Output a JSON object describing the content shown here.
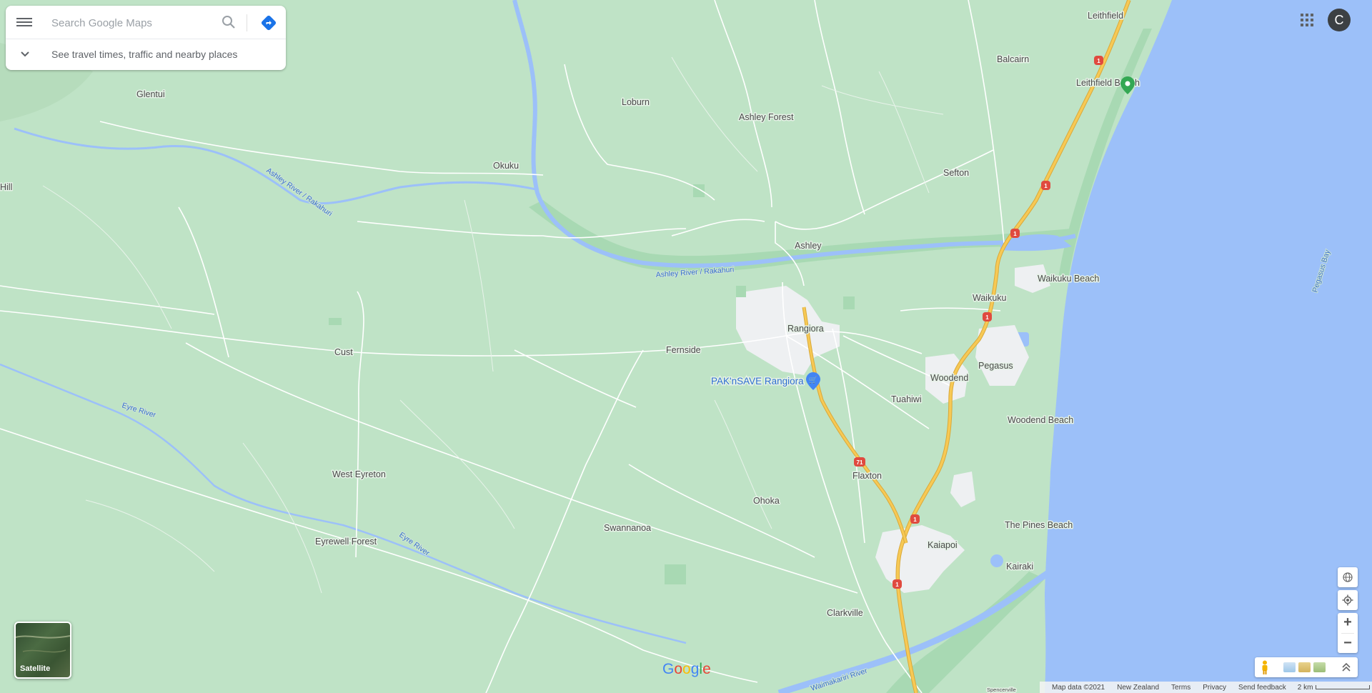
{
  "search": {
    "placeholder": "Search Google Maps",
    "travel_hint": "See travel times, traffic and nearby places"
  },
  "account": {
    "avatar_letter": "C"
  },
  "map_labels": {
    "places": [
      "Leithfield",
      "Balcairn",
      "Leithfield Beach",
      "Loburn",
      "Ashley Forest",
      "Glentui",
      "Okuku",
      "Sefton",
      "Hill",
      "Ashley",
      "Waikuku Beach",
      "Waikuku",
      "Rangiora",
      "Cust",
      "Fernside",
      "Pegasus",
      "Woodend",
      "Tuahiwi",
      "Woodend Beach",
      "West Eyreton",
      "Flaxton",
      "Ohoka",
      "Swannanoa",
      "Kaiapoi",
      "The Pines Beach",
      "Eyrewell Forest",
      "Kairaki",
      "Clarkville",
      "Spencerville"
    ],
    "water": [
      "Ashley River / Rakahuri",
      "Ashley River / Rakahuri",
      "Eyre River",
      "Eyre River",
      "Waimakariri River",
      "Pegasus Bay"
    ],
    "poi": "PAK'nSAVE Rangiora",
    "highway_shields": [
      "1",
      "1",
      "1",
      "1",
      "71",
      "1",
      "1"
    ],
    "logo": "Google"
  },
  "map_type_toggle": {
    "label": "Satellite"
  },
  "footer": {
    "map_data": "Map data ©2021",
    "country": "New Zealand",
    "terms": "Terms",
    "privacy": "Privacy",
    "feedback": "Send feedback",
    "scale": "2 km"
  },
  "icons": [
    "menu-icon",
    "search-icon",
    "directions-icon",
    "chevron-down-icon",
    "apps-grid-icon",
    "globe-icon",
    "my-location-icon",
    "zoom-in-icon",
    "zoom-out-icon",
    "pegman-icon",
    "expand-icon",
    "park-pin-icon",
    "shopping-cart-icon"
  ],
  "colors": {
    "land": "#bfe3c6",
    "water": "#9cc0f9",
    "urban": "#eef0f2",
    "park": "#a8d9b3",
    "highway": "#f7c955",
    "shield": "#e04a3f"
  }
}
